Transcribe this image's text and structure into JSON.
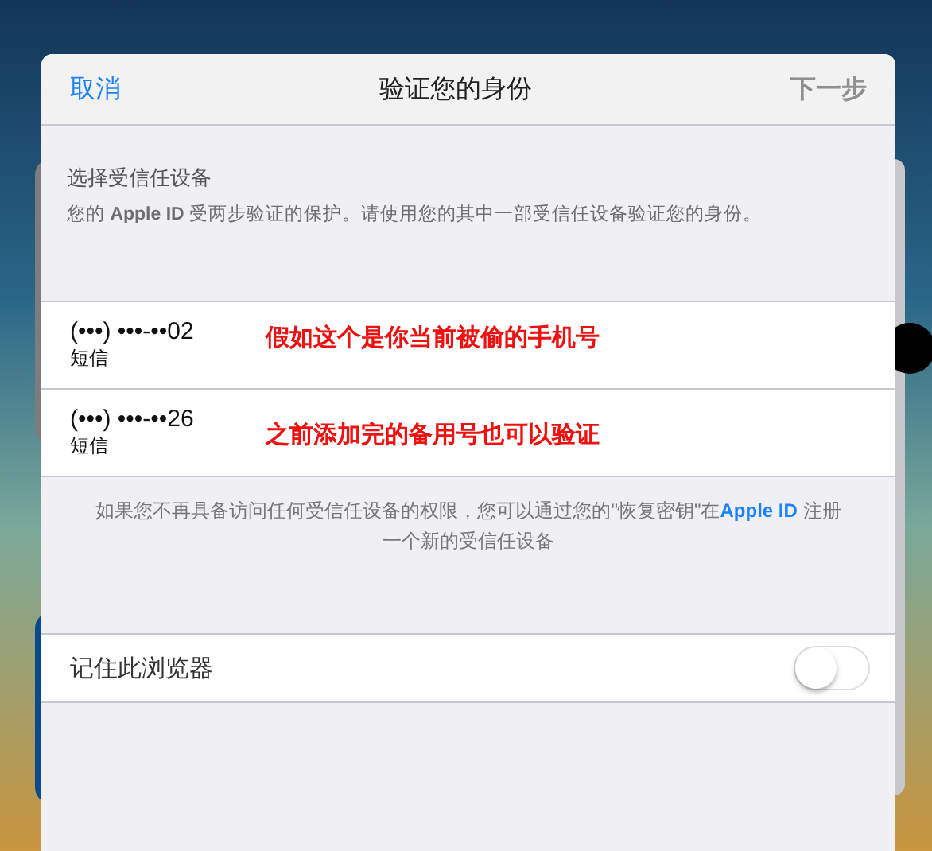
{
  "header": {
    "cancel": "取消",
    "title": "验证您的身份",
    "next": {
      "label": "下一步",
      "disabled": true
    }
  },
  "section": {
    "title": "选择受信任设备",
    "description": "您的 **Apple ID** 受两步验证的保护。请使用您的其中一部受信任设备验证您的身份。"
  },
  "devices": [
    {
      "number": "(•••) •••-••02",
      "method": "短信",
      "annotation": "假如这个是你当前被偷的手机号"
    },
    {
      "number": "(•••) •••-••26",
      "method": "短信",
      "annotation": "之前添加完的备用号也可以验证"
    }
  ],
  "note": {
    "before": "如果您不再具备访问任何受信任设备的权限，您可以通过您的\"恢复密钥\"在",
    "link": "Apple ID",
    "after": " 注册一个新的受信任设备"
  },
  "remember": {
    "label": "记住此浏览器",
    "on": false
  }
}
